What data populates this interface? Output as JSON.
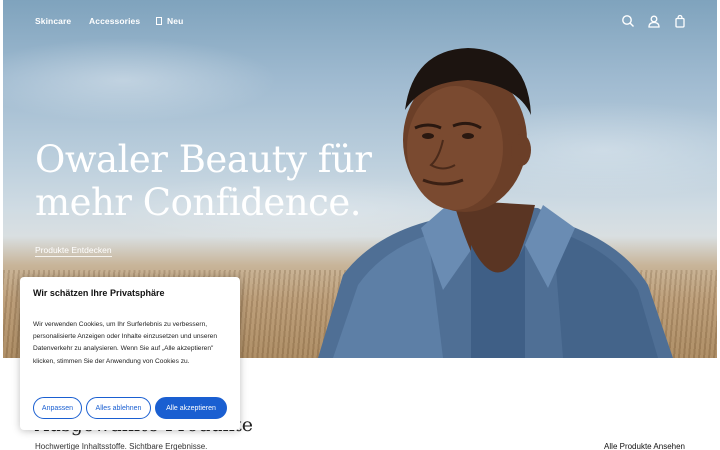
{
  "nav": {
    "items": [
      {
        "label": "Skincare"
      },
      {
        "label": "Accessories"
      },
      {
        "label": "Neu"
      }
    ],
    "icons": [
      "search-icon",
      "account-icon",
      "cart-icon"
    ]
  },
  "hero": {
    "headline": "Owaler Beauty für mehr Confidence.",
    "cta_label": "Produkte Entdecken"
  },
  "featured": {
    "title": "Ausgewählte Produkte",
    "subtitle": "Hochwertige Inhaltsstoffe. Sichtbare Ergebnisse.",
    "view_all_label": "Alle Produkte Ansehen"
  },
  "cookie": {
    "title": "Wir schätzen Ihre Privatsphäre",
    "body": "Wir verwenden Cookies, um Ihr Surferlebnis zu verbessern, personalisierte Anzeigen oder Inhalte einzusetzen und unseren Datenverkehr zu analysieren. Wenn Sie auf „Alle akzeptieren\" klicken, stimmen Sie der Anwendung von Cookies zu.",
    "customize_label": "Anpassen",
    "reject_label": "Alles ablehnen",
    "accept_label": "Alle akzeptieren",
    "accent_color": "#1a5fd1"
  }
}
